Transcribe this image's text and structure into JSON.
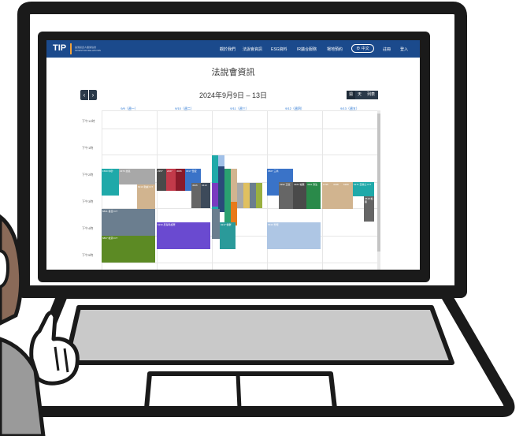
{
  "nav": {
    "logo_text": "TIP",
    "logo_subtitle": "臺灣投資人關係協會 INVESTOR RELATIONS",
    "items": [
      "觀於我們",
      "法說會資訊",
      "ESG資料",
      "IR議合服務",
      "場地預約"
    ],
    "language": "中文",
    "register": "註冊",
    "login": "登入"
  },
  "page": {
    "title": "法說會資訊",
    "date_range": "2024年9月9日 – 13日",
    "prev_label": "‹",
    "next_label": "›",
    "view_buttons": [
      "週",
      "天",
      "列表"
    ]
  },
  "calendar": {
    "days": [
      "9/9（週一）",
      "9/10（週二）",
      "9/11（週三）",
      "9/12（週四）",
      "9/13（週五）"
    ],
    "time_labels": [
      "下午12時",
      "下午1時",
      "下午2時",
      "下午3時",
      "下午4時",
      "下午5時"
    ],
    "events": [
      {
        "code": "1560",
        "name": "中砂"
      },
      {
        "code": "2376",
        "name": "技嘉"
      },
      {
        "code": "8210",
        "name": "勤誠 ICT"
      },
      {
        "code": "6841",
        "name": "長佳 ICT"
      },
      {
        "code": "6807",
        "name": "峰源 ICT"
      },
      {
        "code": "2357",
        "name": "華碩"
      },
      {
        "code": "2467",
        "name": "志聖"
      },
      {
        "code": "3006",
        "name": "晶豪"
      },
      {
        "code": "3017",
        "name": "奇鋐"
      },
      {
        "code": "4916",
        "name": "事欣科"
      },
      {
        "code": "3413",
        "name": "京鼎"
      },
      {
        "code": "6230",
        "name": "尼得科超眾"
      },
      {
        "code": "3217",
        "name": "優群"
      },
      {
        "code": "3507",
        "name": "三商"
      },
      {
        "code": "2392",
        "name": "正崴"
      },
      {
        "code": "3484",
        "name": "崧騰"
      },
      {
        "code": "4111",
        "name": "濟生"
      },
      {
        "code": "1795",
        "name": "美時"
      },
      {
        "code": "4138",
        "name": "曜亞"
      },
      {
        "code": "6180",
        "name": "橘子"
      },
      {
        "code": "6171",
        "name": "亞銳士 ICT"
      },
      {
        "code": "3518",
        "name": "柏騰"
      },
      {
        "code": "8916",
        "name": "光隆"
      },
      {
        "code": "5536",
        "name": "聖暉"
      }
    ]
  },
  "colors": {
    "nav": "#1b4a8c",
    "accent_orange": "#f2a23a",
    "link_blue": "#1f6fd0"
  }
}
